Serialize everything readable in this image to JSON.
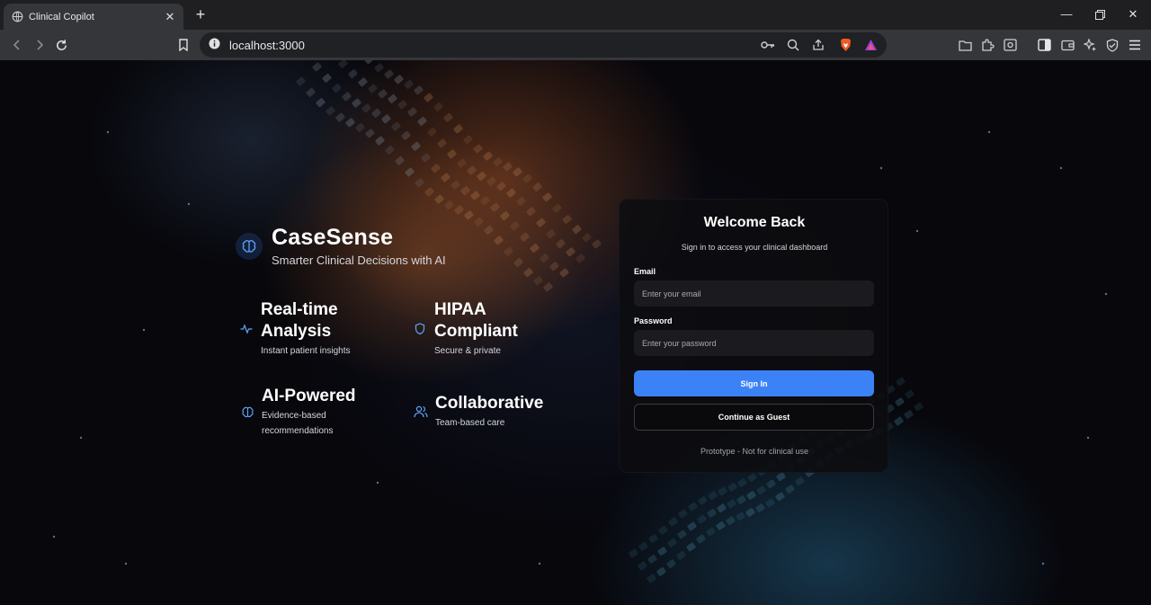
{
  "browser": {
    "tab_title": "Clinical Copilot",
    "url": "localhost:3000"
  },
  "brand": {
    "name": "CaseSense",
    "tagline": "Smarter Clinical Decisions with AI",
    "accent": "#3b82f6"
  },
  "features": [
    {
      "title_line1": "Real-time",
      "title_line2": "Analysis",
      "desc_line1": "Instant patient insights",
      "desc_line2": "",
      "icon": "activity-icon"
    },
    {
      "title_line1": "HIPAA",
      "title_line2": "Compliant",
      "desc_line1": "Secure & private",
      "desc_line2": "",
      "icon": "shield-icon"
    },
    {
      "title_line1": "AI-Powered",
      "title_line2": "",
      "desc_line1": "Evidence-based",
      "desc_line2": "recommendations",
      "icon": "brain-icon"
    },
    {
      "title_line1": "Collaborative",
      "title_line2": "",
      "desc_line1": "Team-based care",
      "desc_line2": "",
      "icon": "users-icon"
    }
  ],
  "login": {
    "title": "Welcome Back",
    "subtitle": "Sign in to access your clinical dashboard",
    "email_label": "Email",
    "email_placeholder": "Enter your email",
    "password_label": "Password",
    "password_placeholder": "Enter your password",
    "sign_in_label": "Sign In",
    "guest_label": "Continue as Guest",
    "footer": "Prototype - Not for clinical use"
  }
}
